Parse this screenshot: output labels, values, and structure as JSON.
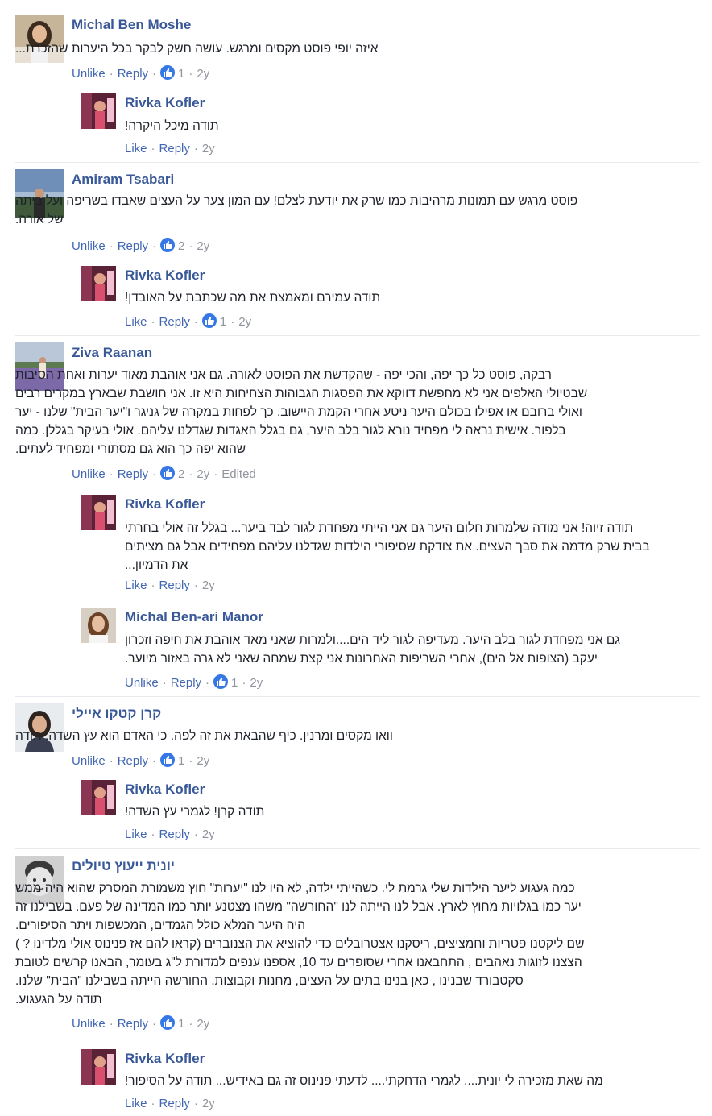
{
  "comments": [
    {
      "name": "Michal Ben Moshe",
      "text": "איזה יופי פוסט מקסים ומרגש. עושה חשק לבקר בכל היערות שהזכרת...",
      "action": "Unlike",
      "reply": "Reply",
      "like_count": "1",
      "time": "2y",
      "avatar": "avatar-woman-long-hair",
      "replies": [
        {
          "name": "Rivka Kofler",
          "text": "תודה מיכל היקרה!",
          "action": "Like",
          "reply": "Reply",
          "time": "2y",
          "avatar": "avatar-rivka"
        }
      ]
    },
    {
      "name": "Amiram Tsabari",
      "text": "פוסט מרגש עם תמונות מרהיבות כמו שרק את יודעת לצלם! עם המון צער על העצים שאבדו בשריפה ועל ביתה\nשל אורה.",
      "action": "Unlike",
      "reply": "Reply",
      "like_count": "2",
      "time": "2y",
      "avatar": "avatar-man-landscape",
      "replies": [
        {
          "name": "Rivka Kofler",
          "text": "תודה עמירם ומאמצת את מה שכתבת על האובדן!",
          "action": "Like",
          "reply": "Reply",
          "like_count": "1",
          "time": "2y",
          "avatar": "avatar-rivka"
        }
      ]
    },
    {
      "name": "Ziva Raanan",
      "text": "רבקה, פוסט כל כך יפה, והכי יפה - שהקדשת את הפוסט לאורה. גם אני אוהבת מאוד יערות ואחת הסיבות\nשבטיולי האלפים אני לא מחפשת דווקא את הפסגות הגבוהות הצחיחות היא זו. אני חושבת שבארץ במקרים רבים\nואולי ברובם או אפילו בכולם היער ניטע אחרי הקמת היישוב. כך לפחות במקרה של גניגר ו\"יער הבית\" שלנו - יער\nבלפור. אישית נראה לי מפחיד נורא לגור בלב היער, גם בגלל האגדות שגדלנו עליהם. אולי בעיקר בגללן. כמה\nשהוא יפה כך הוא גם מסתורי ומפחיד לעתים.",
      "action": "Unlike",
      "reply": "Reply",
      "like_count": "2",
      "time": "2y",
      "edited": "Edited",
      "avatar": "avatar-woman-lavender",
      "replies": [
        {
          "name": "Rivka Kofler",
          "text": "תודה זיוה! אני מודה שלמרות חלום היער גם אני הייתי מפחדת לגור לבד ביער... בגלל זה אולי בחרתי\nבבית שרק מדמה את סבך העצים. את צודקת שסיפורי הילדות שגדלנו עליהם מפחידים אבל גם מציתים\nאת הדמיון...",
          "action": "Like",
          "reply": "Reply",
          "time": "2y",
          "avatar": "avatar-rivka"
        },
        {
          "name": "Michal Ben-ari Manor",
          "text": "גם אני מפחדת לגור בלב היער. מעדיפה לגור ליד הים....ולמרות שאני מאד אוהבת את חיפה וזכרון\nיעקב (הצופות אל הים), אחרי השריפות האחרונות אני קצת שמחה שאני לא גרה באזור מיוער.",
          "action": "Unlike",
          "reply": "Reply",
          "like_count": "1",
          "time": "2y",
          "avatar": "avatar-woman-smiling"
        }
      ]
    },
    {
      "name": "קרן קטקו איילי",
      "text": "וואו מקסים ומרנין. כיף שהבאת את זה לפה. כי האדם הוא עץ השדה. תודה",
      "action": "Unlike",
      "reply": "Reply",
      "like_count": "1",
      "time": "2y",
      "avatar": "avatar-woman-dark-hair",
      "replies": [
        {
          "name": "Rivka Kofler",
          "text": "תודה קרן! לגמרי עץ השדה!",
          "action": "Like",
          "reply": "Reply",
          "time": "2y",
          "avatar": "avatar-rivka"
        }
      ]
    },
    {
      "name": "יונית ייעוץ טיולים",
      "text": "כמה געגוע ליער הילדות שלי גרמת לי. כשהייתי ילדה, לא היו לנו \"יערות\" חוץ משמורת המסרק שהוא היה ממש\nיער כמו בגלויות מחוץ לארץ. אבל לנו הייתה לנו \"החורשה\" משהו מצטנע יותר כמו המדינה של פעם. בשבילנו זה\nהיה היער המלא כולל הגמדים, המכשפות ויתר הסיפורים.\nשם ליקטנו פטריות וחמציצים, ריסקנו אצטרובלים כדי להוציא את הצנוברים (קראו להם אז פנינוס אולי מלדינו ? )\nהצצנו לזוגות נאהבים , התחבאנו אחרי שסופרים עד 10, אספנו ענפים למדורת ל\"ג בעומר, הבאנו קרשים לטובת\nסקטבורד שבנינו , כאן בנינו בתים על העצים, מחנות וקבוצות. החורשה הייתה בשבילנו \"הבית\" שלנו.\nתודה על הגעגוע.",
      "action": "Unlike",
      "reply": "Reply",
      "like_count": "1",
      "time": "2y",
      "avatar": "avatar-child-bw",
      "replies": [
        {
          "name": "Rivka Kofler",
          "text": "מה שאת מזכירה לי יונית.... לגמרי הדחקתי.... לדעתי פנינוס זה גם באידיש... תודה על הסיפור!",
          "action": "Like",
          "reply": "Reply",
          "time": "2y",
          "avatar": "avatar-rivka"
        }
      ]
    }
  ],
  "colors": {
    "link": "#4267b2",
    "name": "#385898",
    "meta": "#90949c",
    "like_badge": "#3578e5"
  }
}
